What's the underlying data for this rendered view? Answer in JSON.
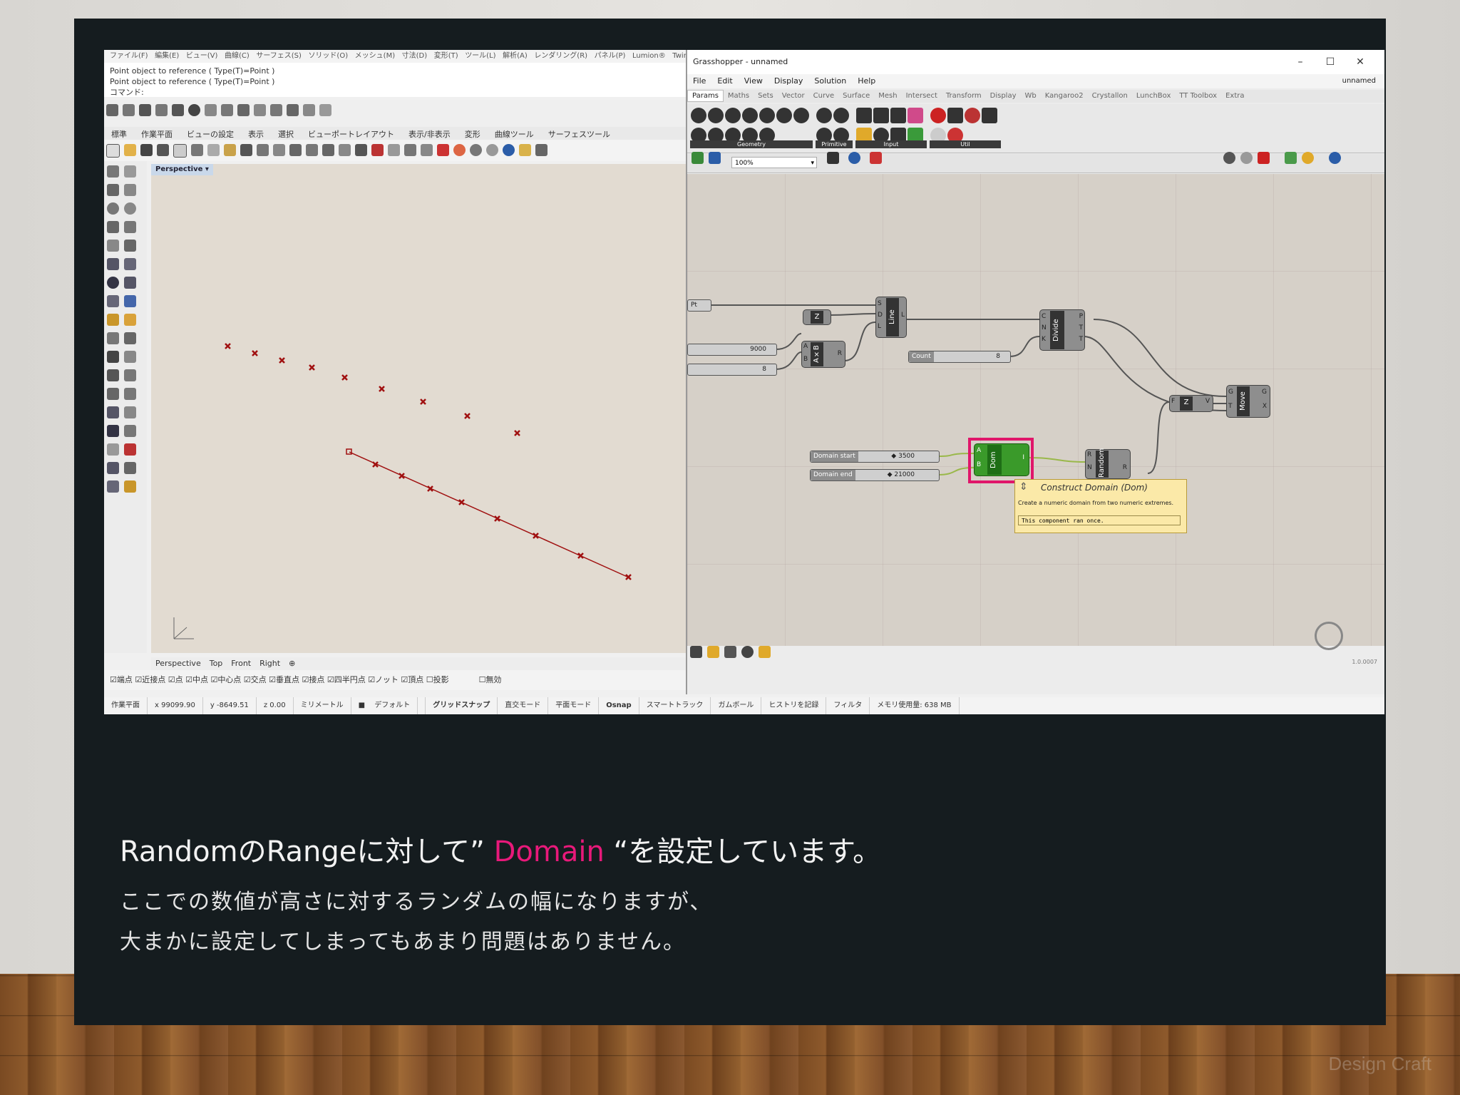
{
  "rhino": {
    "menu": [
      "ファイル(F)",
      "編集(E)",
      "ビュー(V)",
      "曲線(C)",
      "サーフェス(S)",
      "ソリッド(O)",
      "メッシュ(M)",
      "寸法(D)",
      "変形(T)",
      "ツール(L)",
      "解析(A)",
      "レンダリング(R)",
      "パネル(P)",
      "Lumion®",
      "Twinm"
    ],
    "cmd_lines": [
      "Point object to reference ( Type(T)=Point )",
      "Point object to reference ( Type(T)=Point )",
      "コマンド:"
    ],
    "toolbar_tabs": [
      "標準",
      "作業平面",
      "ビューの設定",
      "表示",
      "選択",
      "ビューポートレイアウト",
      "表示/非表示",
      "変形",
      "曲線ツール",
      "サーフェスツール"
    ],
    "viewport_label": "Perspective",
    "viewport_tabs": [
      "Perspective",
      "Top",
      "Front",
      "Right"
    ],
    "osnap": [
      "端点",
      "近接点",
      "点",
      "中点",
      "中心点",
      "交点",
      "垂直点",
      "接点",
      "四半円点",
      "ノット",
      "頂点",
      "投影",
      "無効"
    ],
    "status": [
      "作業平面",
      "x 99099.90",
      "y -8649.51",
      "z 0.00",
      "ミリメートル",
      "デフォルト",
      "グリッドスナップ",
      "直交モード",
      "平面モード",
      "Osnap",
      "スマートトラック",
      "ガムボール",
      "ヒストリを記録",
      "フィルタ",
      "メモリ使用量: 638 MB"
    ]
  },
  "gh": {
    "title": "Grasshopper - unnamed",
    "menu": [
      "File",
      "Edit",
      "View",
      "Display",
      "Solution",
      "Help"
    ],
    "doc_name": "unnamed",
    "tabs": [
      "Params",
      "Maths",
      "Sets",
      "Vector",
      "Curve",
      "Surface",
      "Mesh",
      "Intersect",
      "Transform",
      "Display",
      "Wb",
      "Kangaroo2",
      "Crystallon",
      "LunchBox",
      "TT Toolbox",
      "Extra"
    ],
    "ribbon_groups": [
      "Geometry",
      "Primitive",
      "Input",
      "Util"
    ],
    "zoom": "100%",
    "components": {
      "line": "Line",
      "divide": "Divide",
      "axb": "A×B",
      "move": "Move",
      "dom": "Dom",
      "random": "Random",
      "unit_z": "Z"
    },
    "params": {
      "pt": "Pt",
      "n9000": "9000",
      "n8": "8",
      "count_label": "Count",
      "count_val": "8",
      "dstart_label": "Domain start",
      "dstart_val": "3500",
      "dend_label": "Domain end",
      "dend_val": "21000"
    },
    "tooltip": {
      "title": "Construct Domain (Dom)",
      "desc": "Create a numeric domain from two numeric extremes.",
      "note": "This component ran once."
    },
    "version": "1.0.0007"
  },
  "caption": {
    "line1_pre": "RandomのRangeに対して” ",
    "line1_highlight": "Domain",
    "line1_post": " “を設定しています。",
    "line2": "ここでの数値が高さに対するランダムの幅になりますが、",
    "line3": "大まかに設定してしまってもあまり問題はありません。"
  },
  "watermark": "Design Craft"
}
